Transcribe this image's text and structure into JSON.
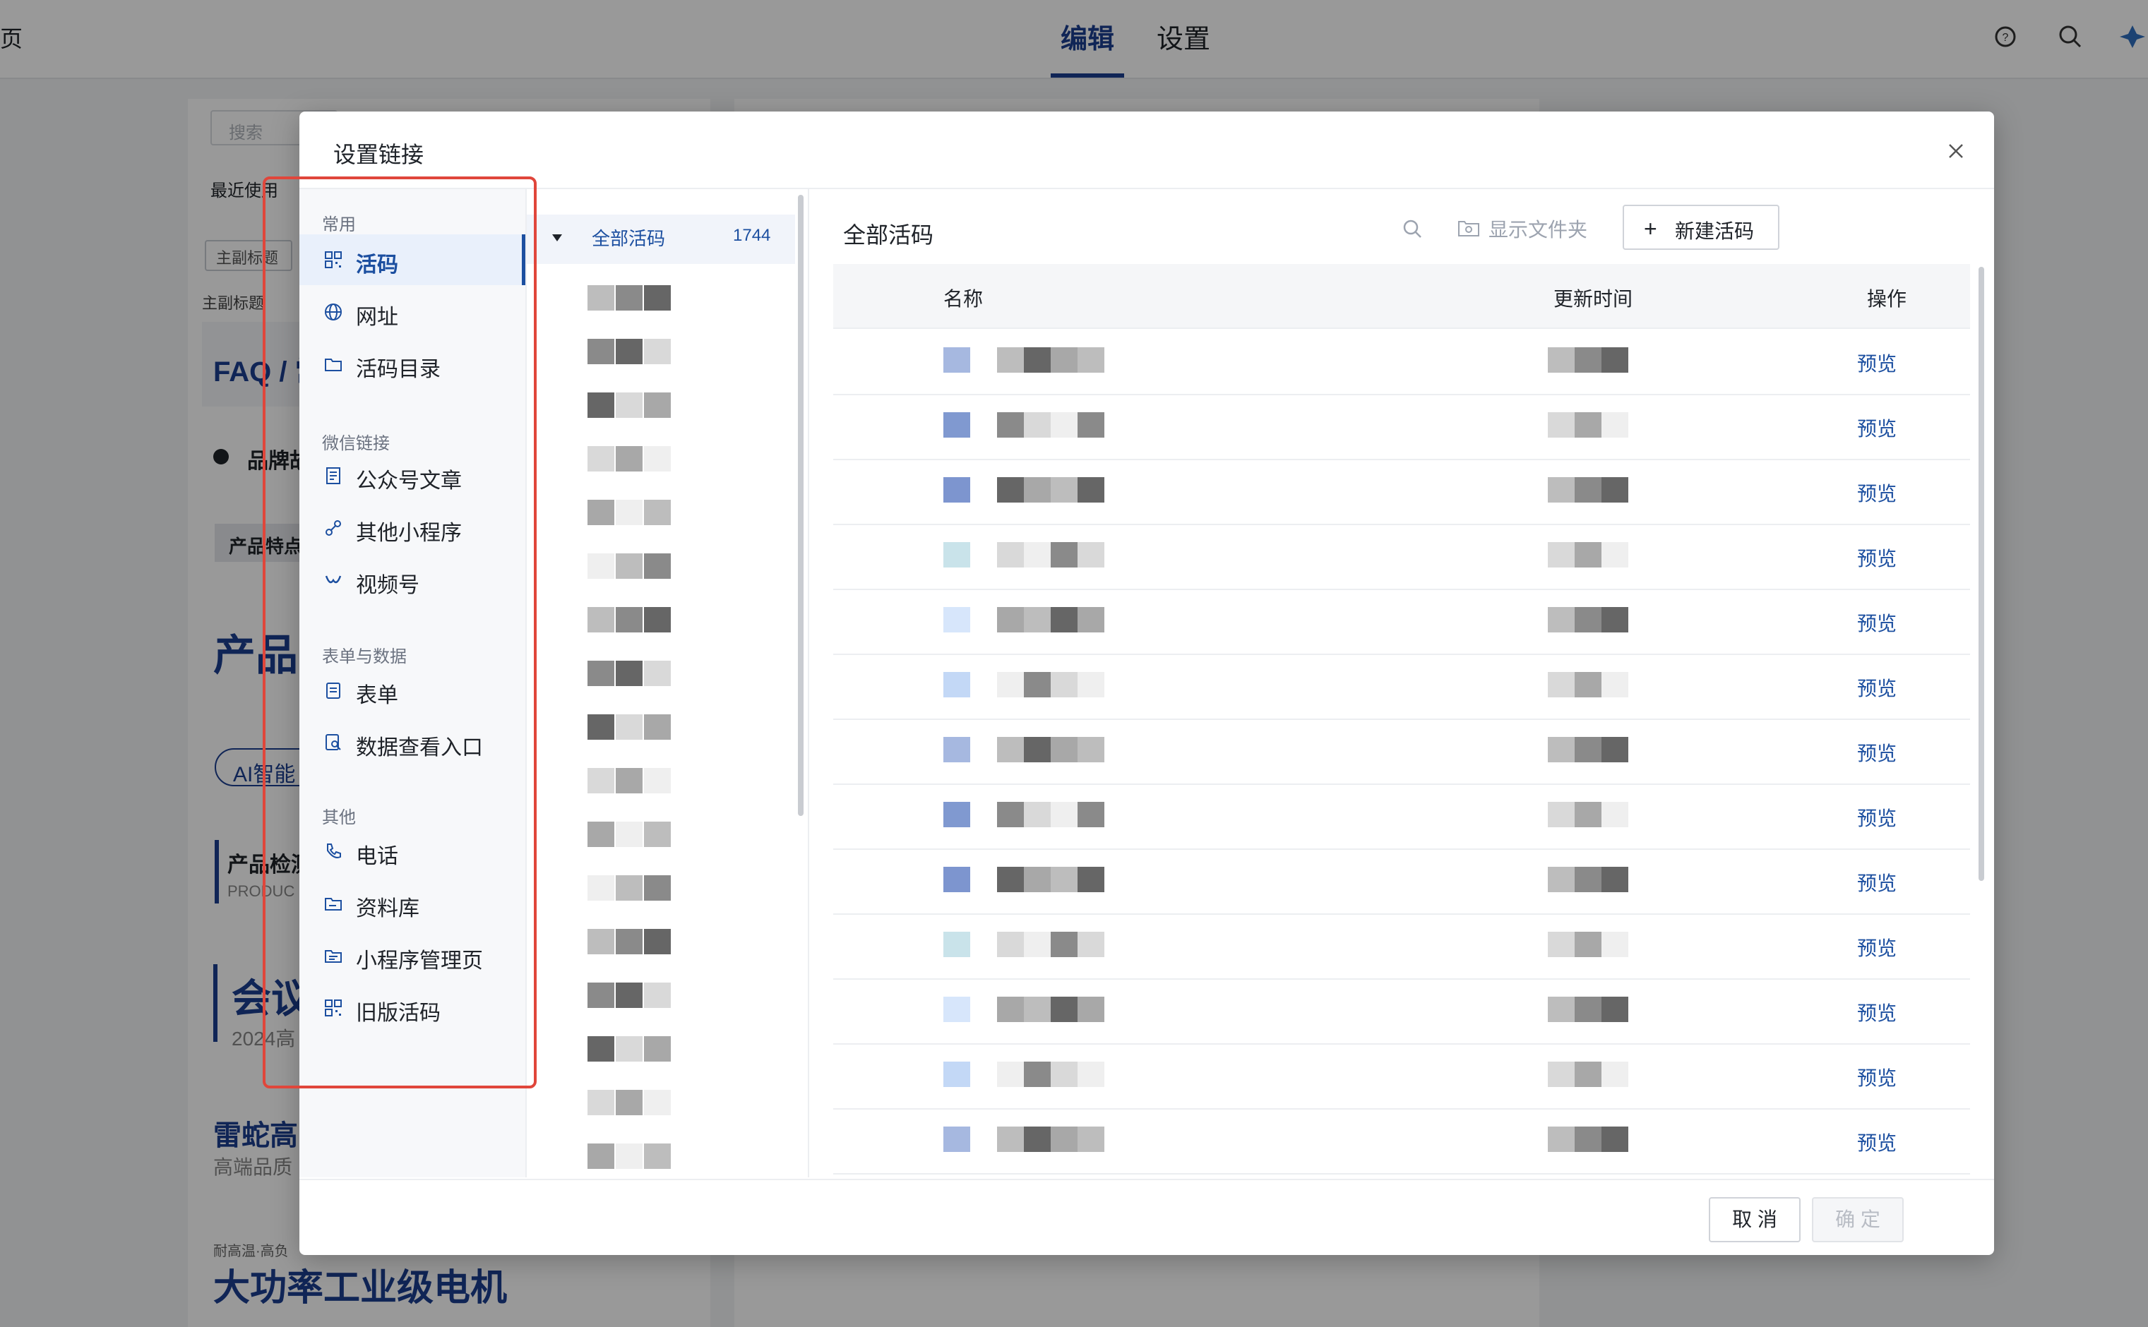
{
  "topbar": {
    "left_fragment": "页",
    "tabs": [
      {
        "label": "编辑",
        "active": true
      },
      {
        "label": "设置",
        "active": false
      }
    ],
    "icons": [
      "help-icon",
      "search-icon",
      "logo-icon"
    ]
  },
  "background_panel": {
    "search_placeholder": "搜索",
    "recent_label": "最近使用",
    "tag_label": "主副标题",
    "section_label": "主副标题",
    "items": [
      "FAQ / 常",
      "品牌故",
      "产品特点",
      "产品",
      "AI智能",
      "产品检测",
      "PRODUC",
      "会议",
      "2024高",
      "雷蛇高",
      "高端品质",
      "耐高温·高负",
      "大功率工业级电机"
    ]
  },
  "modal": {
    "title": "设置链接",
    "sidebar": {
      "groups": [
        {
          "title": "常用",
          "items": [
            {
              "label": "活码",
              "icon": "qrcode-icon",
              "active": true
            },
            {
              "label": "网址",
              "icon": "globe-icon",
              "active": false
            },
            {
              "label": "活码目录",
              "icon": "folder-icon",
              "active": false
            }
          ]
        },
        {
          "title": "微信链接",
          "items": [
            {
              "label": "公众号文章",
              "icon": "article-icon",
              "active": false
            },
            {
              "label": "其他小程序",
              "icon": "link-icon",
              "active": false
            },
            {
              "label": "视频号",
              "icon": "channels-icon",
              "active": false
            }
          ]
        },
        {
          "title": "表单与数据",
          "items": [
            {
              "label": "表单",
              "icon": "form-icon",
              "active": false
            },
            {
              "label": "数据查看入口",
              "icon": "data-view-icon",
              "active": false
            }
          ]
        },
        {
          "title": "其他",
          "items": [
            {
              "label": "电话",
              "icon": "phone-icon",
              "active": false
            },
            {
              "label": "资料库",
              "icon": "library-icon",
              "active": false
            },
            {
              "label": "小程序管理页",
              "icon": "miniapp-icon",
              "active": false
            },
            {
              "label": "旧版活码",
              "icon": "qrcode-icon",
              "active": false
            }
          ]
        }
      ]
    },
    "tree": {
      "root_label": "全部活码",
      "root_count": "1744"
    },
    "content": {
      "title": "全部活码",
      "show_folder_label": "显示文件夹",
      "new_button_label": "新建活码",
      "columns": {
        "name": "名称",
        "updated": "更新时间",
        "action": "操作"
      },
      "row_action_label": "预览",
      "row_count": 13
    },
    "footer": {
      "cancel_label": "取 消",
      "ok_label": "确 定"
    }
  },
  "colors": {
    "accent": "#1c4fa0",
    "highlight_border": "#e0463b",
    "overlay": "rgba(0,0,0,0.40)"
  }
}
